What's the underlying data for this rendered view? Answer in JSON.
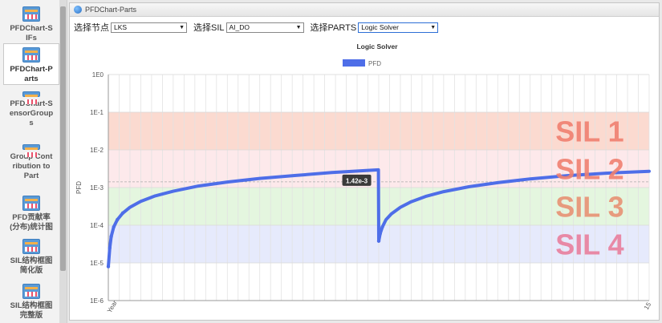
{
  "sidebar": {
    "items": [
      {
        "label": "PFDChart-S\nIFs",
        "active": false
      },
      {
        "label": "PFDChart-P\narts",
        "active": true
      },
      {
        "label": "PFDChart-S\nensorGroup\ns",
        "active": false
      },
      {
        "label": "Group Cont\nribution to\nPart",
        "active": false
      },
      {
        "label": "PFD贡献率\n(分布)统计图",
        "active": false
      },
      {
        "label": "SIL结构框图\n简化版",
        "active": false
      },
      {
        "label": "SIL结构框图\n完整版",
        "active": false
      }
    ]
  },
  "panel": {
    "title": "PFDChart-Parts"
  },
  "controls": {
    "node_label": "选择节点",
    "node_value": "LKS",
    "sil_label": "选择SIL",
    "sil_value": "AI_DO",
    "parts_label": "选择PARTS",
    "parts_value": "Logic Solver"
  },
  "chart_data": {
    "type": "line",
    "title": "Logic Solver",
    "ylabel": "PFD",
    "y_scale": "log",
    "ylim": [
      1e-06,
      1
    ],
    "y_ticks": [
      "1E0",
      "1E-1",
      "1E-2",
      "1E-3",
      "1E-4",
      "1E-5",
      "1E-6"
    ],
    "x_ticks": {
      "first": "Year",
      "last": "15"
    },
    "xlim": [
      0,
      15
    ],
    "grid": true,
    "legend": {
      "placement": "top-center",
      "entries": [
        "PFD"
      ]
    },
    "series": [
      {
        "name": "PFD",
        "color": "#4e6ee8",
        "x": [
          0,
          0.04,
          0.08,
          0.15,
          0.25,
          0.4,
          0.6,
          0.9,
          1.3,
          1.8,
          2.5,
          3.3,
          4.2,
          5.2,
          6.2,
          7.2,
          7.49,
          7.5,
          7.54,
          7.6,
          7.7,
          7.85,
          8.1,
          8.4,
          8.8,
          9.3,
          10.0,
          10.8,
          11.7,
          12.7,
          13.8,
          15.0
        ],
        "values": [
          8e-06,
          2.5e-05,
          5e-05,
          9e-05,
          0.00014,
          0.00021,
          0.0003,
          0.00043,
          0.0006,
          0.0008,
          0.0011,
          0.0014,
          0.00175,
          0.0021,
          0.0025,
          0.00285,
          0.00295,
          3.8e-05,
          6e-05,
          9e-05,
          0.00014,
          0.0002,
          0.0003,
          0.00042,
          0.00058,
          0.00078,
          0.00105,
          0.00135,
          0.0017,
          0.00205,
          0.0024,
          0.0027
        ]
      }
    ],
    "bands": [
      {
        "label": "SIL 1",
        "from": 0.01,
        "to": 0.1,
        "fill": "#fad4c8",
        "text_color": "#f08070"
      },
      {
        "label": "SIL 2",
        "from": 0.001,
        "to": 0.01,
        "fill": "#fde5e8",
        "text_color": "#f08070"
      },
      {
        "label": "SIL 3",
        "from": 0.0001,
        "to": 0.001,
        "fill": "#dff5d9",
        "text_color": "#e89274"
      },
      {
        "label": "SIL 4",
        "from": 1e-05,
        "to": 0.0001,
        "fill": "#e2e6fb",
        "text_color": "#e97f9d"
      }
    ],
    "reference_line": {
      "value": 0.00142,
      "label": "1.42e-3",
      "x": 7.49
    }
  }
}
